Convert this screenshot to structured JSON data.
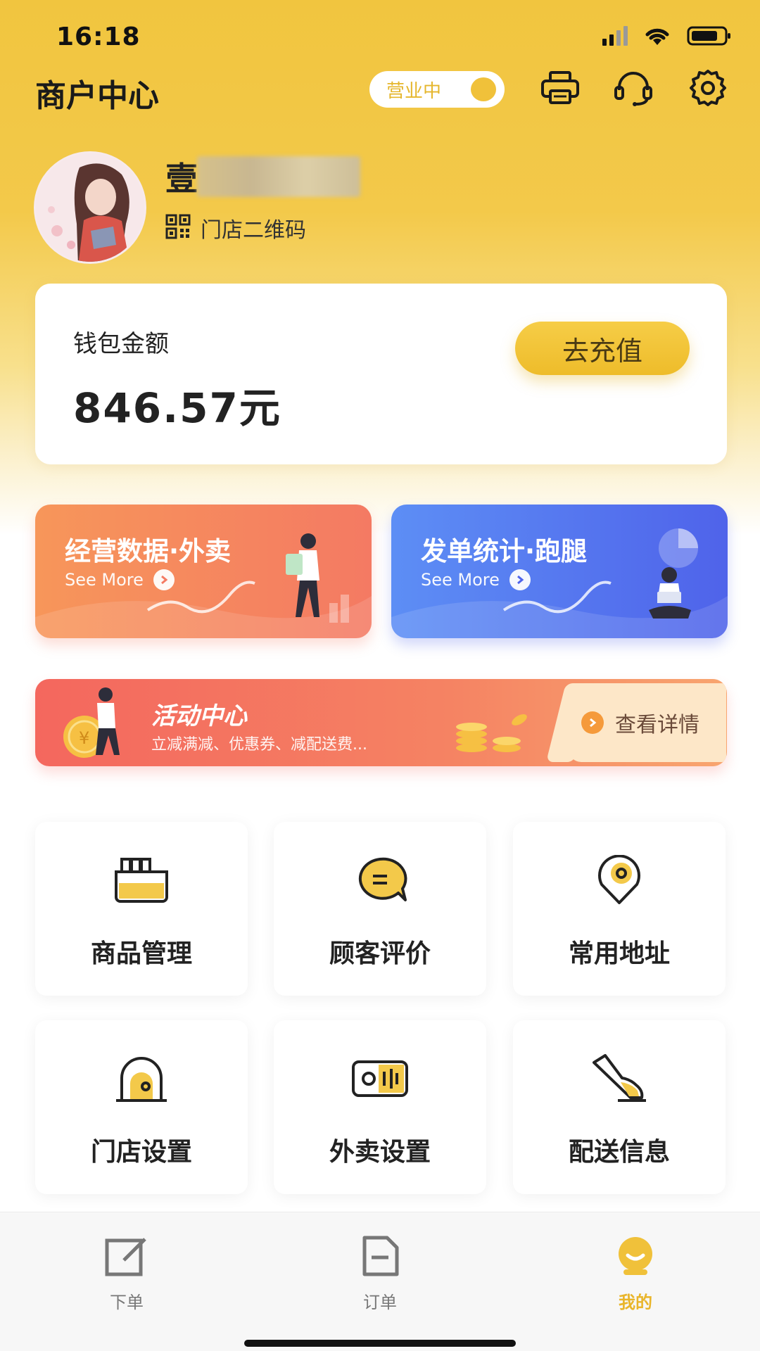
{
  "status_bar": {
    "time": "16:18"
  },
  "header": {
    "title": "商户中心",
    "business_status": "营业中",
    "icons": [
      "printer-icon",
      "headset-icon",
      "settings-icon"
    ]
  },
  "profile": {
    "store_name_visible": "壹",
    "qr_label": "门店二维码"
  },
  "wallet": {
    "label": "钱包金额",
    "amount": "846.57元",
    "recharge_label": "去充值"
  },
  "features": [
    {
      "title": "经营数据·外卖",
      "subtitle": "See More"
    },
    {
      "title": "发单统计·跑腿",
      "subtitle": "See More"
    }
  ],
  "activity": {
    "title": "活动中心",
    "subtitle": "立减满减、优惠券、减配送费...",
    "action_label": "查看详情"
  },
  "grid": [
    {
      "label": "商品管理",
      "icon": "goods-icon"
    },
    {
      "label": "顾客评价",
      "icon": "comment-icon"
    },
    {
      "label": "常用地址",
      "icon": "location-icon"
    },
    {
      "label": "门店设置",
      "icon": "store-icon"
    },
    {
      "label": "外卖设置",
      "icon": "delivery-settings-icon"
    },
    {
      "label": "配送信息",
      "icon": "shoe-icon"
    }
  ],
  "bottom_nav": [
    {
      "label": "下单",
      "icon": "edit-icon",
      "active": false
    },
    {
      "label": "订单",
      "icon": "order-icon",
      "active": false
    },
    {
      "label": "我的",
      "icon": "profile-icon",
      "active": true
    }
  ],
  "colors": {
    "accent": "#f1c53f",
    "orange_banner": "#f47a63",
    "blue_banner": "#4f63ea",
    "activity_red": "#f4675e",
    "active_nav": "#e9b52a"
  }
}
